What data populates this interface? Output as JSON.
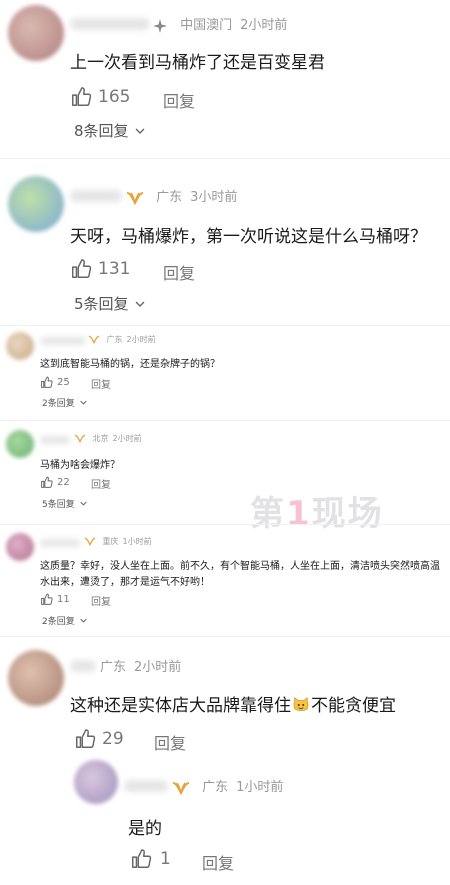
{
  "comments": [
    {
      "location": "中国澳门",
      "time": "2小时前",
      "text": "上一次看到马桶炸了还是百变星君",
      "likes": "165",
      "reply_label": "回复",
      "replies": "8条回复"
    },
    {
      "location": "广东",
      "time": "3小时前",
      "text": "天呀，马桶爆炸，第一次听说这是什么马桶呀？",
      "likes": "131",
      "reply_label": "回复",
      "replies": "5条回复"
    },
    {
      "location": "广东",
      "time": "2小时前",
      "text": "这到底智能马桶的锅，还是杂牌子的锅？",
      "likes": "25",
      "reply_label": "回复",
      "replies": "2条回复"
    },
    {
      "location": "北京",
      "time": "2小时前",
      "text": "马桶为啥会爆炸？",
      "likes": "22",
      "reply_label": "回复",
      "replies": "5条回复"
    },
    {
      "location": "重庆",
      "time": "1小时前",
      "text_line1": "这质量？幸好，没人坐在上面。前不久，有个智能马桶，人坐在上面，清洁喷头突然喷高温",
      "text_line2": "水出来，遭烫了，那才是运气不好哟！",
      "likes": "11",
      "reply_label": "回复",
      "replies": "2条回复"
    },
    {
      "location": "广东",
      "time": "2小时前",
      "text_before": "这种还是实体店大品牌靠得住",
      "text_after": "不能贪便宜",
      "likes": "29",
      "reply_label": "回复"
    },
    {
      "location": "广东",
      "time": "1小时前",
      "text": "是的",
      "likes": "1",
      "reply_label": "回复"
    }
  ],
  "watermark": {
    "prefix": "第",
    "middle": "1",
    "suffix": "现场"
  },
  "colors": {
    "meta": "#9a9a9a",
    "text": "#1a1a1a",
    "badge": "#e8a33a"
  },
  "icons": {
    "like": "thumbs-up-icon",
    "badge": "gold-badge-icon",
    "expand": "chevron-down-icon",
    "emoji": "cat-emoji-icon"
  }
}
